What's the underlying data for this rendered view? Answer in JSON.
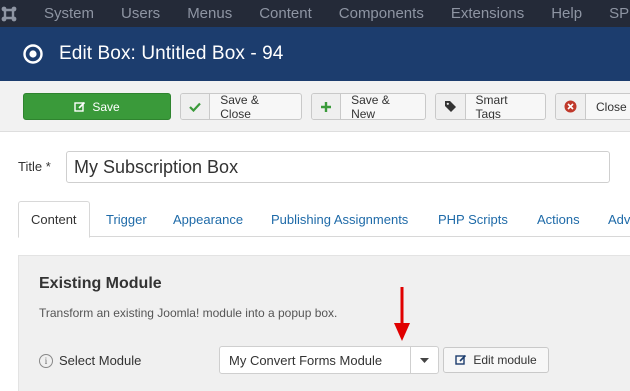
{
  "topnav": {
    "items": [
      "System",
      "Users",
      "Menus",
      "Content",
      "Components",
      "Extensions",
      "Help",
      "SP Pa"
    ]
  },
  "header": {
    "title": "Edit Box: Untitled Box - 94"
  },
  "toolbar": {
    "save_label": "Save",
    "save_close_label": "Save & Close",
    "save_new_label": "Save & New",
    "smart_tags_label": "Smart Tags",
    "close_label": "Close"
  },
  "form": {
    "title_label": "Title *",
    "title_value": "My Subscription Box"
  },
  "tabs": [
    "Content",
    "Trigger",
    "Appearance",
    "Publishing Assignments",
    "PHP Scripts",
    "Actions",
    "Adv"
  ],
  "panel": {
    "title": "Existing Module",
    "description": "Transform an existing Joomla! module into a popup box.",
    "info_glyph": "i",
    "field_label": "Select Module",
    "selected_module": "My Convert Forms Module",
    "edit_label": "Edit module"
  },
  "colors": {
    "topnav_bg": "#242a38",
    "header_bg": "#1c3d6e",
    "save_green": "#3a9a3a",
    "link_blue": "#1e6aa8",
    "arrow_red": "#e00000"
  }
}
